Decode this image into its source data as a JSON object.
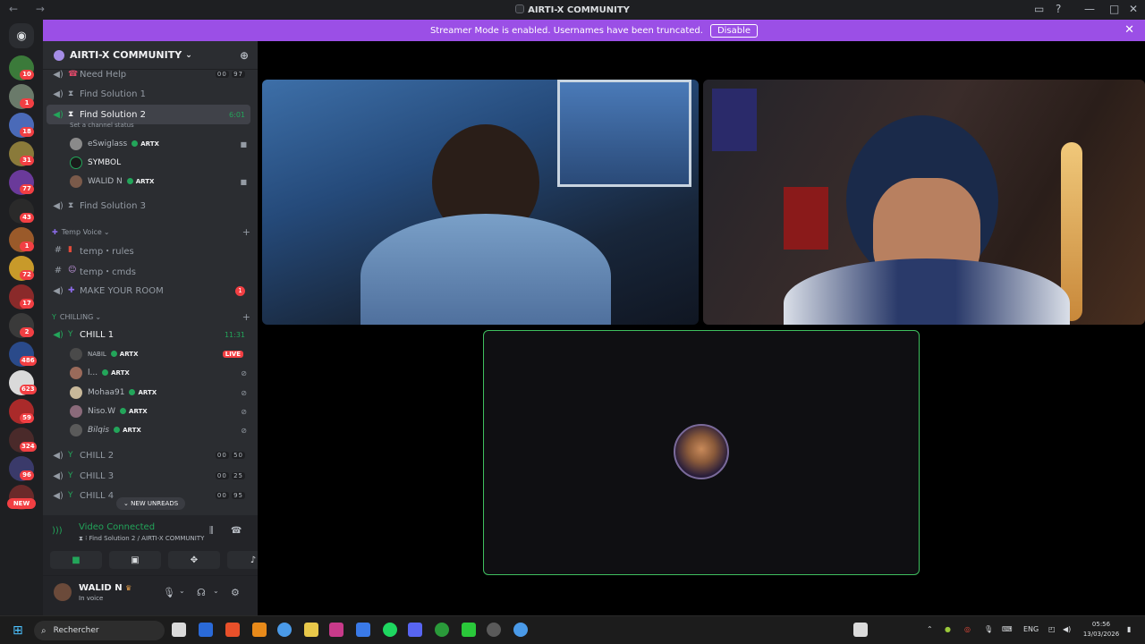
{
  "window": {
    "title": "AIRTI-X COMMUNITY",
    "nav": "← →"
  },
  "banner": {
    "text": "Streamer Mode is enabled. Usernames have been truncated.",
    "disable": "Disable"
  },
  "rail": {
    "badges": [
      "10",
      "1",
      "18",
      "31",
      "77",
      "43",
      "1",
      "72",
      "17",
      "2",
      "486",
      "623",
      "59",
      "324",
      "96"
    ],
    "new": "NEW"
  },
  "server": {
    "name": "AIRTI-X COMMUNITY"
  },
  "channels": {
    "need_help": {
      "label": "Need Help",
      "h": "00",
      "m": "97"
    },
    "fs1": {
      "label": "Find Solution 1"
    },
    "fs2": {
      "label": "Find Solution 2",
      "time": "6:01",
      "status": "Set a channel status"
    },
    "fs3": {
      "label": "Find Solution 3"
    },
    "temp_voice": "Temp Voice",
    "temp_rules": "temp・rules",
    "temp_cmds": "temp・cmds",
    "make_room": {
      "label": "MAKE YOUR ROOM",
      "count": "1"
    },
    "chilling": "CHILLING",
    "chill1": {
      "label": "CHILL 1",
      "time": "11:31"
    },
    "chill2": {
      "label": "CHILL 2",
      "h": "00",
      "m": "50"
    },
    "chill3": {
      "label": "CHILL 3",
      "h": "00",
      "m": "25"
    },
    "chill4": {
      "label": "CHILL 4",
      "h": "00",
      "m": "95"
    }
  },
  "users_fs2": [
    {
      "name": "eSwiglass",
      "tag": "ARTX"
    },
    {
      "name": "SYMBOL",
      "tag": ""
    },
    {
      "name": "WALID N",
      "tag": "ARTX"
    }
  ],
  "users_chill1": [
    {
      "name": "NABIL",
      "tag": "ARTX",
      "live": "LIVE"
    },
    {
      "name": "l...",
      "tag": "ARTX"
    },
    {
      "name": "Mohaa91",
      "tag": "ARTX"
    },
    {
      "name": "Niso.W",
      "tag": "ARTX"
    },
    {
      "name": "Bilqis",
      "tag": "ARTX"
    }
  ],
  "new_unreads": "NEW UNREADS",
  "voice": {
    "status": "Video Connected",
    "channel": "Find Solution 2 / AIRTI-X COMMUNITY"
  },
  "me": {
    "name": "WALID N",
    "state": "In voice"
  },
  "taskbar": {
    "search": "Rechercher",
    "lang": "ENG",
    "time": "05:56",
    "date": "13/03/2026"
  },
  "colors": {
    "banner": "#9b4fe6",
    "voice_green": "#23a55a",
    "live_red": "#f23f43"
  }
}
